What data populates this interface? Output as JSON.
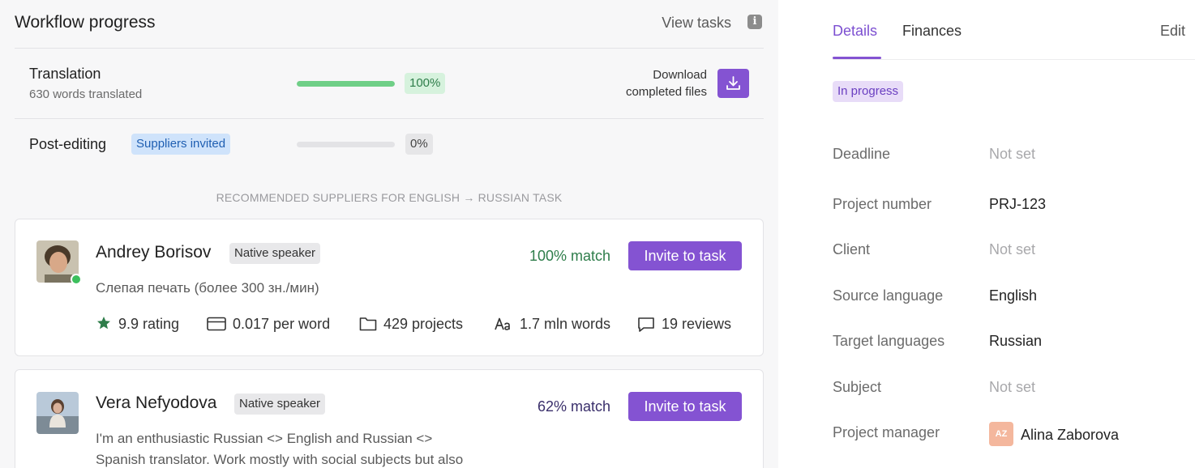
{
  "workflow": {
    "title": "Workflow progress",
    "view_tasks": "View tasks",
    "stages": [
      {
        "name": "Translation",
        "subtitle": "630 words translated",
        "percent": 100,
        "percent_label": "100%",
        "download_label_1": "Download",
        "download_label_2": "completed files"
      },
      {
        "name": "Post-editing",
        "badge": "Suppliers invited",
        "percent": 0,
        "percent_label": "0%"
      }
    ],
    "recommended_heading": "RECOMMENDED SUPPLIERS FOR ENGLISH → RUSSIAN TASK"
  },
  "suppliers": [
    {
      "name": "Andrey Borisov",
      "badge": "Native speaker",
      "match": "100% match",
      "invite": "Invite to task",
      "description": "Слепая печать (более 300 зн./мин)",
      "stats": {
        "rating": "9.9 rating",
        "price": "0.017 per word",
        "projects": "429 projects",
        "words": "1.7 mln words",
        "reviews": "19 reviews"
      }
    },
    {
      "name": "Vera Nefyodova",
      "badge": "Native speaker",
      "match": "62% match",
      "invite": "Invite to task",
      "description_1": "I'm an enthusiastic Russian <> English and Russian <>",
      "description_2": "Spanish translator. Work mostly with social subjects but also"
    }
  ],
  "details": {
    "tabs": [
      "Details",
      "Finances"
    ],
    "edit": "Edit",
    "status": "In progress",
    "rows": [
      {
        "label": "Deadline",
        "value": "Not set"
      },
      {
        "label": "Project number",
        "value": "PRJ-123"
      },
      {
        "label": "Client",
        "value": "Not set"
      },
      {
        "label": "Source language",
        "value": "English"
      },
      {
        "label": "Target languages",
        "value": "Russian"
      },
      {
        "label": "Subject",
        "value": "Not set"
      },
      {
        "label": "Project manager",
        "value": "Alina Zaborova",
        "initials": "AZ"
      }
    ]
  },
  "colors": {
    "accent": "#8453d2",
    "progress_green": "#6fcf87",
    "online": "#3cbf5d",
    "match_high": "#2e7d4a",
    "match_mid": "#3a2f6b"
  }
}
